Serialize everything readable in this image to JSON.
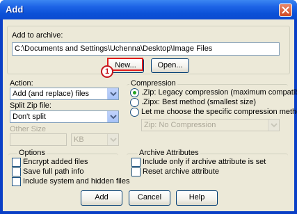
{
  "window": {
    "title": "Add"
  },
  "archive": {
    "label": "Add to archive:",
    "path": "C:\\Documents and Settings\\Uchenna\\Desktop\\Image Files",
    "new_button": "New...",
    "open_button": "Open...",
    "callout_number": "1",
    "callout_color": "#e01b1b"
  },
  "action": {
    "label": "Action:",
    "value": "Add (and replace) files"
  },
  "split": {
    "label": "Split Zip file:",
    "value": "Don't split"
  },
  "other_size": {
    "label": "Other Size",
    "unit": "KB"
  },
  "compression": {
    "legend": "Compression",
    "options": [
      {
        "label": ".Zip: Legacy compression (maximum compatibility)",
        "selected": true
      },
      {
        "label": ".Zipx: Best method (smallest size)",
        "selected": false
      },
      {
        "label": "Let me choose the specific compression method",
        "selected": false
      }
    ],
    "method_value": "Zip: No Compression"
  },
  "options": {
    "legend": "Options",
    "items": [
      "Encrypt added files",
      "Save full path info",
      "Include system and hidden files"
    ]
  },
  "archive_attributes": {
    "legend": "Archive Attributes",
    "items": [
      "Include only if archive attribute is set",
      "Reset archive attribute"
    ]
  },
  "buttons": {
    "add": "Add",
    "cancel": "Cancel",
    "help": "Help"
  }
}
